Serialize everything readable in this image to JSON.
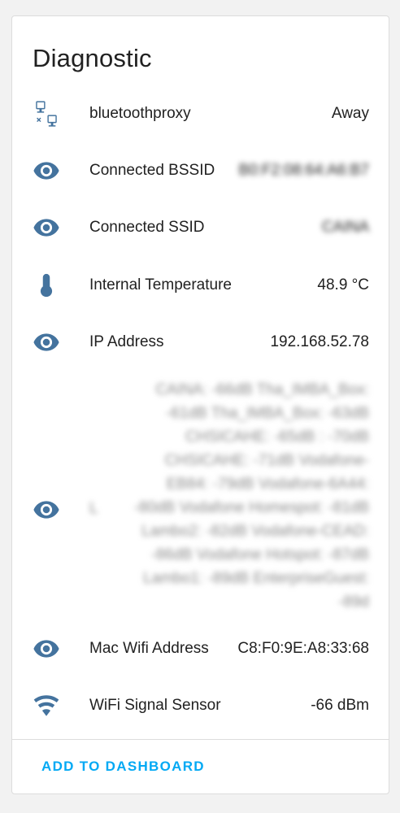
{
  "card": {
    "title": "Diagnostic",
    "action_label": "ADD TO DASHBOARD"
  },
  "accent_color": "#03a9f4",
  "icon_color": "#44739e",
  "rows": [
    {
      "icon": "lan-disconnect-icon",
      "label": "bluetoothproxy",
      "value": "Away"
    },
    {
      "icon": "eye-icon",
      "label": "Connected BSSID",
      "value": "B0:F2:08:64:A6:B7"
    },
    {
      "icon": "eye-icon",
      "label": "Connected SSID",
      "value": "CAINA"
    },
    {
      "icon": "thermometer-icon",
      "label": "Internal Temperature",
      "value": "48.9 °C"
    },
    {
      "icon": "eye-icon",
      "label": "IP Address",
      "value": "192.168.52.78"
    },
    {
      "icon": "eye-icon",
      "label": "L",
      "value": "CAINA: -66dB Tha_IMBA_Box: -61dB Tha_IMBA_Box: -63dB CHSICAHE: -65dB : -70dB CHSICAHE: -71dB Vodafone-EB84: -79dB Vodafone-6A44: -80dB Vodafone Homespot: -81dB Lambo2: -82dB Vodafone-CEAD: -86dB Vodafone Hotspot: -87dB Lambo1: -89dB EnterpriseGuest: -89d"
    },
    {
      "icon": "eye-icon",
      "label": "Mac Wifi Address",
      "value": "C8:F0:9E:A8:33:68"
    },
    {
      "icon": "wifi-icon",
      "label": "WiFi Signal Sensor",
      "value": "-66 dBm"
    }
  ]
}
